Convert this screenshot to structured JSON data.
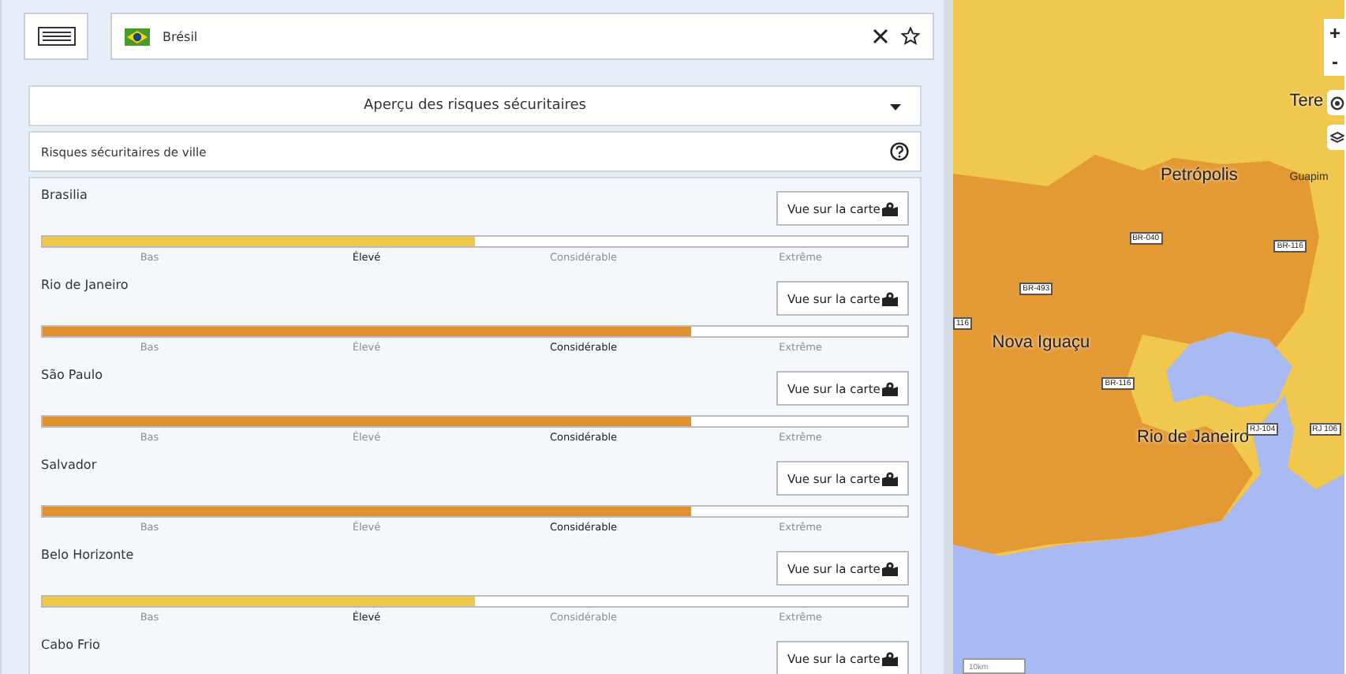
{
  "search": {
    "value": "Brésil"
  },
  "section": {
    "title": "Aperçu des risques sécuritaires",
    "expanded": true
  },
  "subheader": {
    "title": "Risques sécuritaires de ville"
  },
  "cities": [
    {
      "name": "Brasilia",
      "button": "Vue sur la carte",
      "level": 0.5,
      "color": "#f0c94a",
      "scale": [
        {
          "label": "Bas",
          "selected": false
        },
        {
          "label": "Élevé",
          "selected": true
        },
        {
          "label": "Considérable",
          "selected": false
        },
        {
          "label": "Extrême",
          "selected": false
        }
      ]
    },
    {
      "name": "Rio de Janeiro",
      "button": "Vue sur la carte",
      "level": 0.75,
      "color": "#e0922e",
      "scale": [
        {
          "label": "Bas",
          "selected": false
        },
        {
          "label": "Élevé",
          "selected": false
        },
        {
          "label": "Considérable",
          "selected": true
        },
        {
          "label": "Extrême",
          "selected": false
        }
      ]
    },
    {
      "name": "São Paulo",
      "button": "Vue sur la carte",
      "level": 0.75,
      "color": "#e0922e",
      "scale": [
        {
          "label": "Bas",
          "selected": false
        },
        {
          "label": "Élevé",
          "selected": false
        },
        {
          "label": "Considérable",
          "selected": true
        },
        {
          "label": "Extrême",
          "selected": false
        }
      ]
    },
    {
      "name": "Salvador",
      "button": "Vue sur la carte",
      "level": 0.75,
      "color": "#e0922e",
      "scale": [
        {
          "label": "Bas",
          "selected": false
        },
        {
          "label": "Élevé",
          "selected": false
        },
        {
          "label": "Considérable",
          "selected": true
        },
        {
          "label": "Extrême",
          "selected": false
        }
      ]
    },
    {
      "name": "Belo Horizonte",
      "button": "Vue sur la carte",
      "level": 0.5,
      "color": "#f0c94a",
      "scale": [
        {
          "label": "Bas",
          "selected": false
        },
        {
          "label": "Élevé",
          "selected": true
        },
        {
          "label": "Considérable",
          "selected": false
        },
        {
          "label": "Extrême",
          "selected": false
        }
      ]
    },
    {
      "name": "Cabo Frio",
      "button": "Vue sur la carte"
    }
  ],
  "map": {
    "controls": [
      "+",
      "-"
    ],
    "scale": "10km",
    "labels": [
      {
        "text": "Petrópolis",
        "kind": "city"
      },
      {
        "text": "Nova Iguaçu",
        "kind": "city"
      },
      {
        "text": "Rio de Janeiro",
        "kind": "city"
      },
      {
        "text": "Tere",
        "kind": "city"
      },
      {
        "text": "Guapim",
        "kind": "town"
      },
      {
        "text": "BR-040",
        "kind": "road"
      },
      {
        "text": "BR-116",
        "kind": "road"
      },
      {
        "text": "BR-493",
        "kind": "road"
      },
      {
        "text": "116",
        "kind": "road"
      },
      {
        "text": "BR-116",
        "kind": "road"
      },
      {
        "text": "RJ-104",
        "kind": "road"
      },
      {
        "text": "RJ 106",
        "kind": "road"
      }
    ]
  }
}
